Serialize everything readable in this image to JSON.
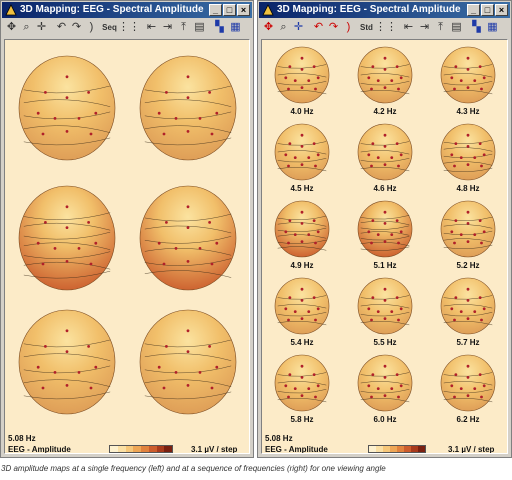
{
  "left_window": {
    "title": "3D Mapping: EEG - Spectral Amplitude",
    "frequency": "5.08 Hz",
    "mode": "EEG - Amplitude",
    "scale": "3.1 µV / step"
  },
  "right_window": {
    "title": "3D Mapping: EEG - Spectral Amplitude",
    "frequency": "5.08 Hz",
    "mode": "EEG - Amplitude",
    "scale": "3.1 µV / step",
    "maps": [
      "4.0 Hz",
      "4.2 Hz",
      "4.3 Hz",
      "4.5 Hz",
      "4.6 Hz",
      "4.8 Hz",
      "4.9 Hz",
      "5.1 Hz",
      "5.2 Hz",
      "5.4 Hz",
      "5.5 Hz",
      "5.7 Hz",
      "5.8 Hz",
      "6.0 Hz",
      "6.2 Hz"
    ]
  },
  "toolbar": {
    "left": [
      "rotate-icon",
      "zoom-icon",
      "move-icon",
      "undo-icon",
      "redo-icon",
      "bracket-icon",
      "seq-icon",
      "grid-icon",
      "separator",
      "bar-left-icon",
      "bar-right-icon",
      "bar-up-icon",
      "select-icon",
      "color-icon",
      "help-icon"
    ],
    "seq_label": "Seq",
    "std_label": "Std"
  },
  "colors": {
    "titlebar": "#0a246a",
    "map_background": "#fcebc8",
    "head_light": "#fbe3a0",
    "head_dark": "#c9582a",
    "scale": [
      "#fdf1cf",
      "#fbe0a4",
      "#f6c77a",
      "#eea656",
      "#e1823e",
      "#cc5c2c",
      "#a83a1c",
      "#7a2010"
    ]
  },
  "caption": "3D amplitude maps at a single frequency (left) and at a sequence of frequencies (right) for one viewing angle"
}
